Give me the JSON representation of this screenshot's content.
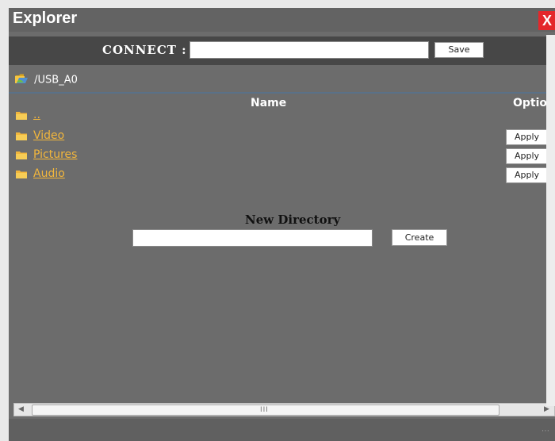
{
  "window": {
    "title": "Explorer",
    "close_label": "X"
  },
  "connect": {
    "label": "CONNECT :",
    "value": "",
    "save_label": "Save"
  },
  "path": {
    "current": "/USB_A0"
  },
  "table": {
    "col_name": "Name",
    "col_options": "Options",
    "rows": [
      {
        "name": "..",
        "apply": ""
      },
      {
        "name": "Video",
        "apply": "Apply"
      },
      {
        "name": "Pictures",
        "apply": "Apply"
      },
      {
        "name": "Audio",
        "apply": "Apply"
      }
    ]
  },
  "new_directory": {
    "label": "New Directory",
    "value": "",
    "create_label": "Create"
  },
  "scrollbar": {
    "grip": "III"
  },
  "colors": {
    "link": "#f2b63c",
    "close": "#e4272b",
    "window_bg": "#6c6c6c",
    "bar_bg": "#474747"
  },
  "icons": {
    "folder": "folder-icon",
    "open_folder": "open-folder-icon"
  }
}
